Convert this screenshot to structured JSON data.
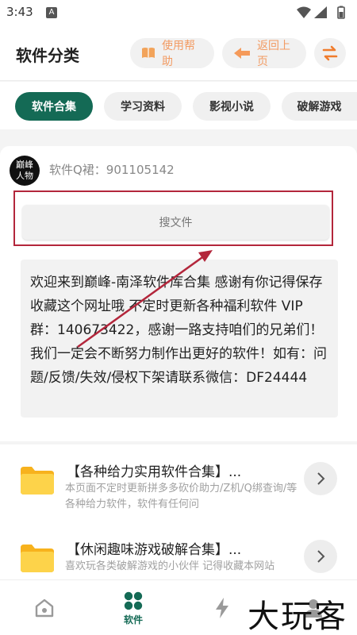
{
  "status_bar": {
    "time": "3:43",
    "notification_letter": "A"
  },
  "header": {
    "title": "软件分类",
    "help_label": "使用帮助",
    "back_label": "返回上页",
    "accent_color": "#f29b63"
  },
  "tabs": [
    {
      "label": "软件合集",
      "active": true
    },
    {
      "label": "学习资料",
      "active": false
    },
    {
      "label": "影视小说",
      "active": false
    },
    {
      "label": "破解游戏",
      "active": false
    }
  ],
  "brand_color": "#146a55",
  "info": {
    "avatar_text": "巅峰人物",
    "qq_group": "软件Q裙：901105142",
    "search_label": "搜文件",
    "notice": "欢迎来到巅峰-南泽软件库合集 感谢有你记得保存收藏这个网址哦 不定时更新各种福利软件 VIP群：140673422，感谢一路支持咱们的兄弟们！我们一定会不断努力制作出更好的软件！如有：问题/反馈/失效/侵权下架请联系微信：DF24444"
  },
  "list": [
    {
      "title": "【各种给力实用软件合集】...",
      "desc": "本页面不定时更新拼多多砍价助力/Z机/Q绑查询/等各种给力软件，软件有任何问",
      "icon": "folder-icon"
    },
    {
      "title": "【休闲趣味游戏破解合集】...",
      "desc": "喜欢玩各类破解游戏的小伙伴 记得收藏本网站",
      "icon": "folder-icon"
    }
  ],
  "bottom_nav": {
    "active_label": "软件"
  },
  "watermark": "大玩客"
}
